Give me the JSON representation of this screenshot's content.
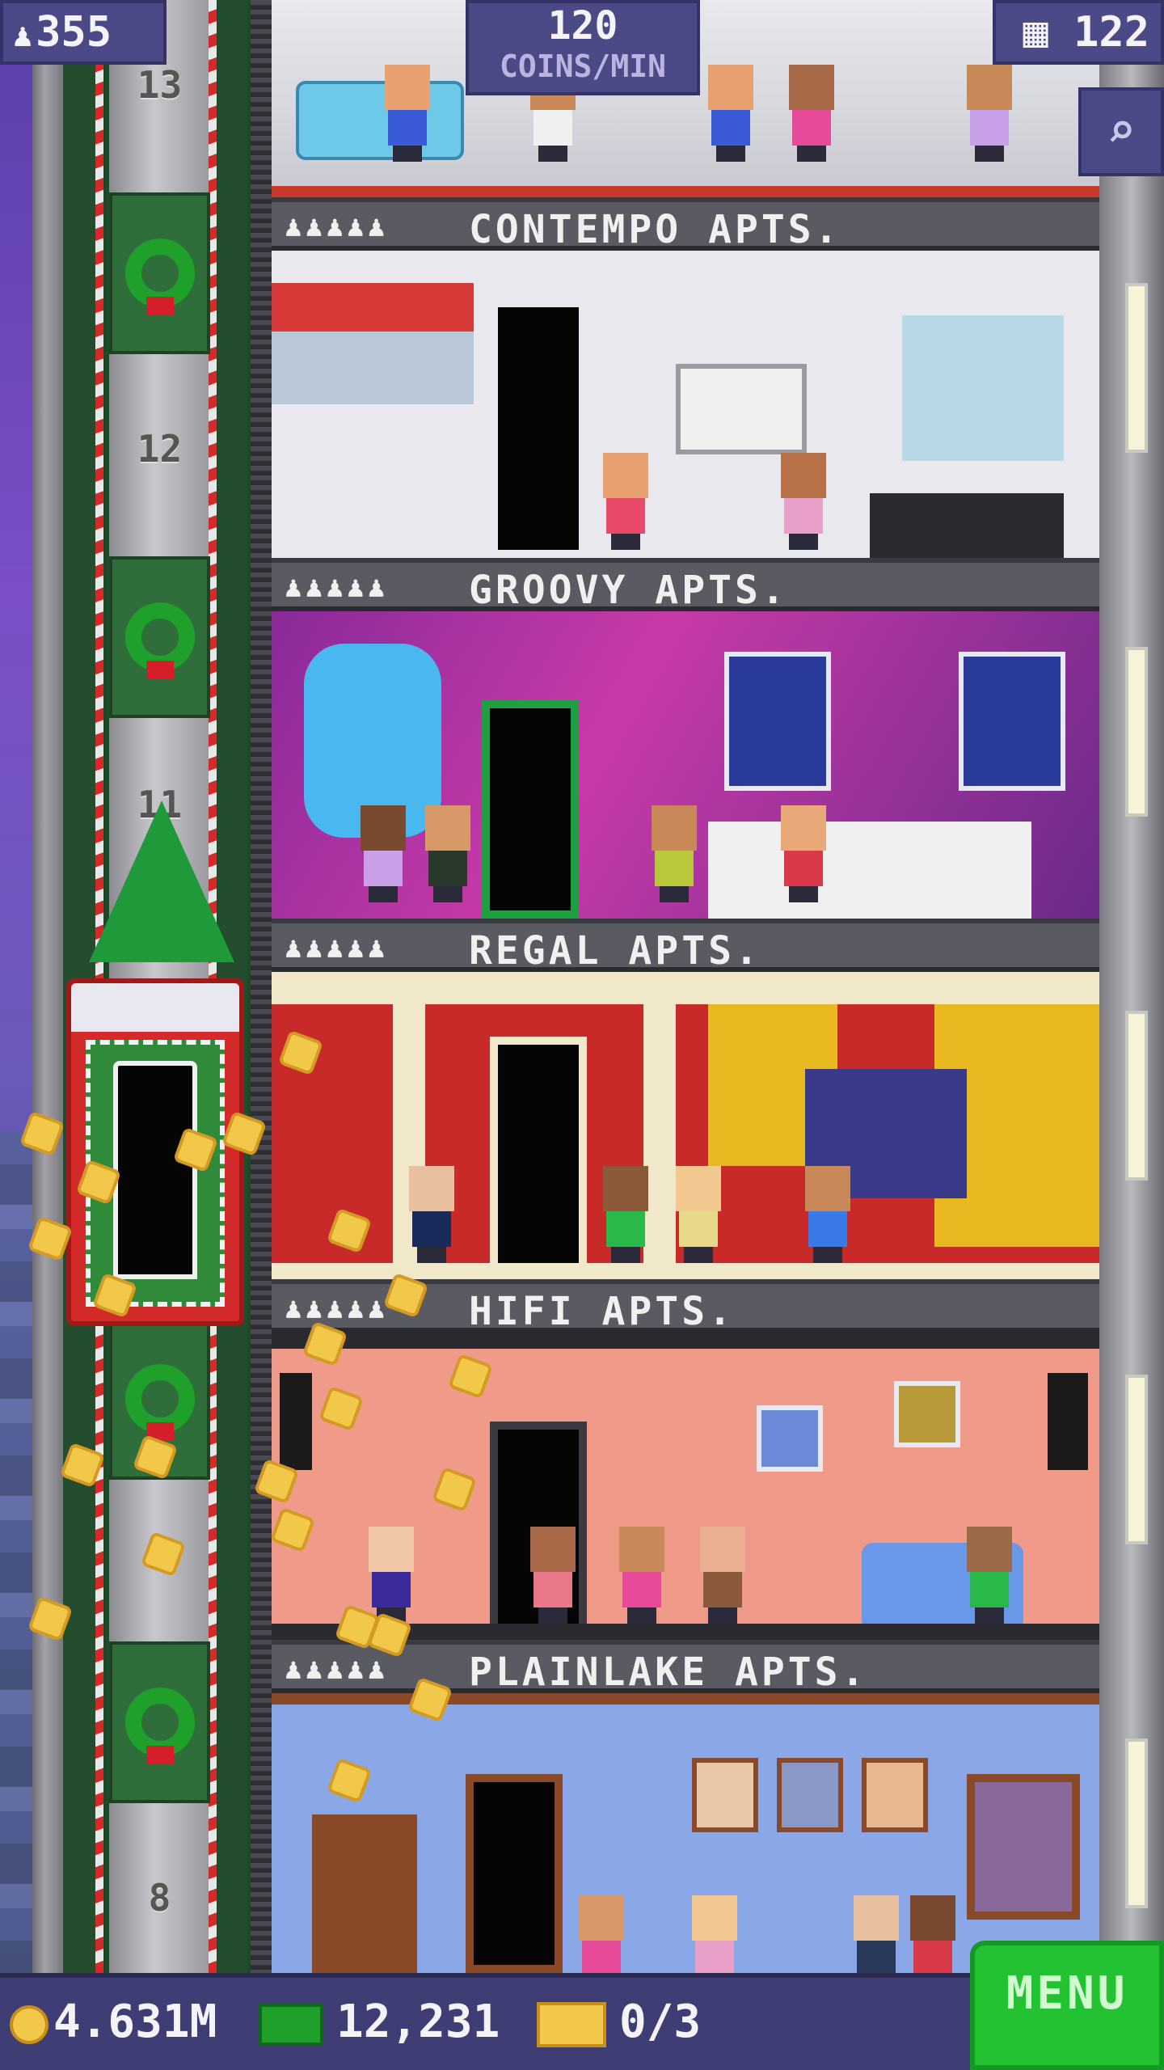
{
  "hud": {
    "population": "355",
    "coins_per_min_value": "120",
    "coins_per_min_unit": "COINS/MIN",
    "floors": "122"
  },
  "shaft": {
    "floor_numbers": [
      "13",
      "12",
      "11",
      "8"
    ]
  },
  "floors": [
    {
      "name": "CONTEMPO APTS.",
      "icons": "♟♟♟♟♟"
    },
    {
      "name": "GROOVY APTS.",
      "icons": "♟♟♟♟♟"
    },
    {
      "name": "REGAL APTS.",
      "icons": "♟♟♟♟♟"
    },
    {
      "name": "HIFI APTS.",
      "icons": "♟♟♟♟♟"
    },
    {
      "name": "PLAINLAKE APTS.",
      "icons": "♟♟♟♟♟"
    }
  ],
  "bottom": {
    "coins": "4.631M",
    "bux": "12,231",
    "vip": "0/3",
    "menu_label": "MENU"
  },
  "colors": {
    "accent_green": "#22c232",
    "hud_bg": "#4c4a86",
    "coin": "#f2c84a"
  },
  "icons": [
    "person-icon",
    "building-icon",
    "magnifier-icon",
    "coin-icon",
    "bux-icon",
    "vip-ticket-icon",
    "wreath-icon",
    "christmas-tree-icon"
  ]
}
